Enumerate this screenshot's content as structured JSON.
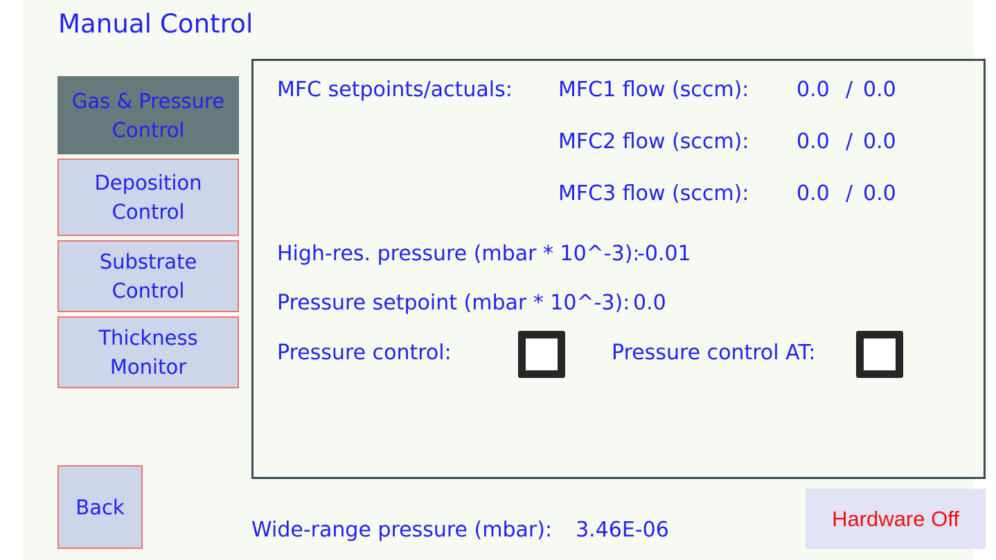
{
  "page": {
    "title": "Manual Control",
    "accent_text_color": "#2222ee",
    "surface_color": "#f7faf3",
    "selected_nav_color": "#66797b",
    "nav_idle_color": "#ccd5e9",
    "nav_border_color": "#f4726f",
    "panel_border_color": "#3e4f52",
    "alarm_color": "#ee1111"
  },
  "sidebar": {
    "items": [
      {
        "label": "Gas & Pressure\nControl",
        "selected": true
      },
      {
        "label": "Deposition\nControl",
        "selected": false
      },
      {
        "label": "Substrate\nControl",
        "selected": false
      },
      {
        "label": "Thickness\nMonitor",
        "selected": false
      }
    ],
    "back_label": "Back"
  },
  "main": {
    "mfc": {
      "heading": "MFC setpoints/actuals:",
      "separator": "/",
      "rows": [
        {
          "label": "MFC1 flow (sccm):",
          "setpoint": "0.0",
          "actual": "0.0"
        },
        {
          "label": "MFC2 flow (sccm):",
          "setpoint": "0.0",
          "actual": "0.0"
        },
        {
          "label": "MFC3 flow (sccm):",
          "setpoint": "0.0",
          "actual": "0.0"
        }
      ]
    },
    "high_res_pressure": {
      "label": "High-res. pressure (mbar * 10^-3):",
      "value": "-0.01"
    },
    "pressure_setpoint": {
      "label": "Pressure setpoint (mbar * 10^-3):",
      "value": "0.0"
    },
    "pressure_control": {
      "label": "Pressure control:",
      "checked": false
    },
    "pressure_control_at": {
      "label": "Pressure control AT:",
      "checked": false
    }
  },
  "footer": {
    "wide_range_label": "Wide-range pressure (mbar):",
    "wide_range_value": "3.46E-06",
    "hardware_status": "Hardware Off"
  }
}
